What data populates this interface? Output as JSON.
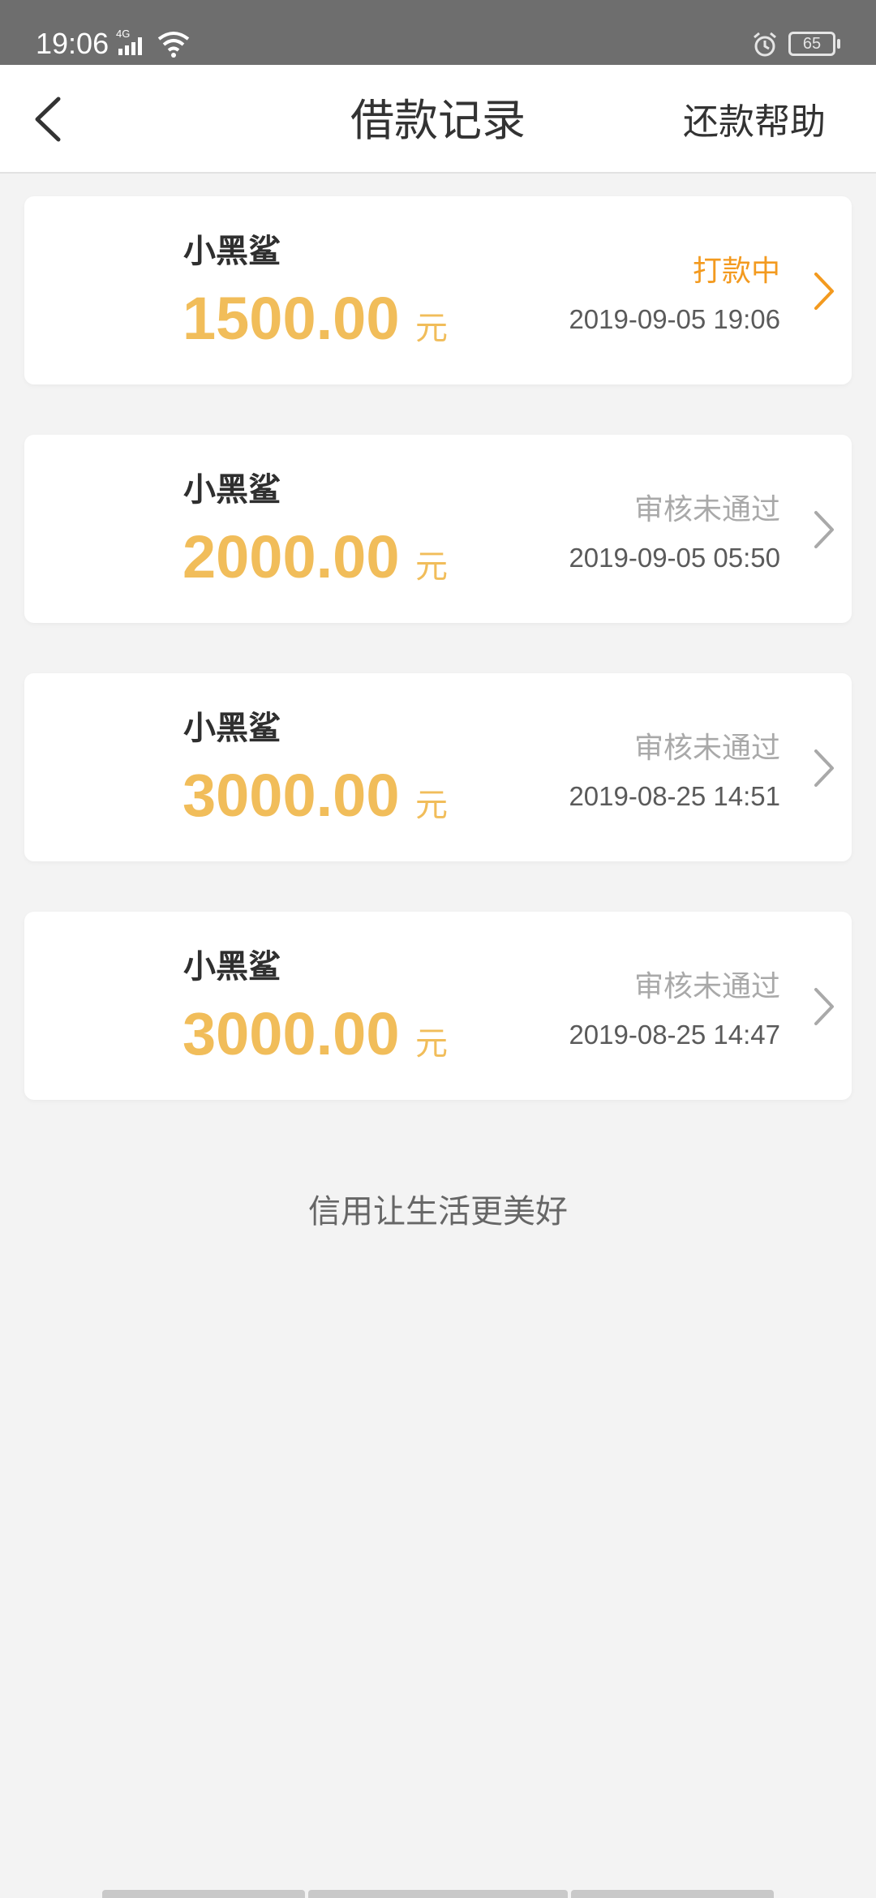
{
  "status_bar": {
    "time": "19:06",
    "network_type": "4G",
    "battery_level": "65"
  },
  "header": {
    "title": "借款记录",
    "help_label": "还款帮助"
  },
  "records": [
    {
      "name": "小黑鲨",
      "amount": "1500.00",
      "unit": "元",
      "status": "打款中",
      "datetime": "2019-09-05 19:06"
    },
    {
      "name": "小黑鲨",
      "amount": "2000.00",
      "unit": "元",
      "status": "审核未通过",
      "datetime": "2019-09-05 05:50"
    },
    {
      "name": "小黑鲨",
      "amount": "3000.00",
      "unit": "元",
      "status": "审核未通过",
      "datetime": "2019-08-25 14:51"
    },
    {
      "name": "小黑鲨",
      "amount": "3000.00",
      "unit": "元",
      "status": "审核未通过",
      "datetime": "2019-08-25 14:47"
    }
  ],
  "footer": {
    "slogan": "信用让生活更美好"
  },
  "colors": {
    "accent": "#f1bd5a",
    "status_active": "#f39a1f",
    "status_rejected": "#a9a9a9",
    "status_bar": "#6e6e6e",
    "background": "#f3f3f3"
  },
  "icons": [
    "signal-icon",
    "wifi-icon",
    "alarm-icon",
    "battery-icon",
    "back-arrow-icon",
    "chevron-right-icon"
  ]
}
